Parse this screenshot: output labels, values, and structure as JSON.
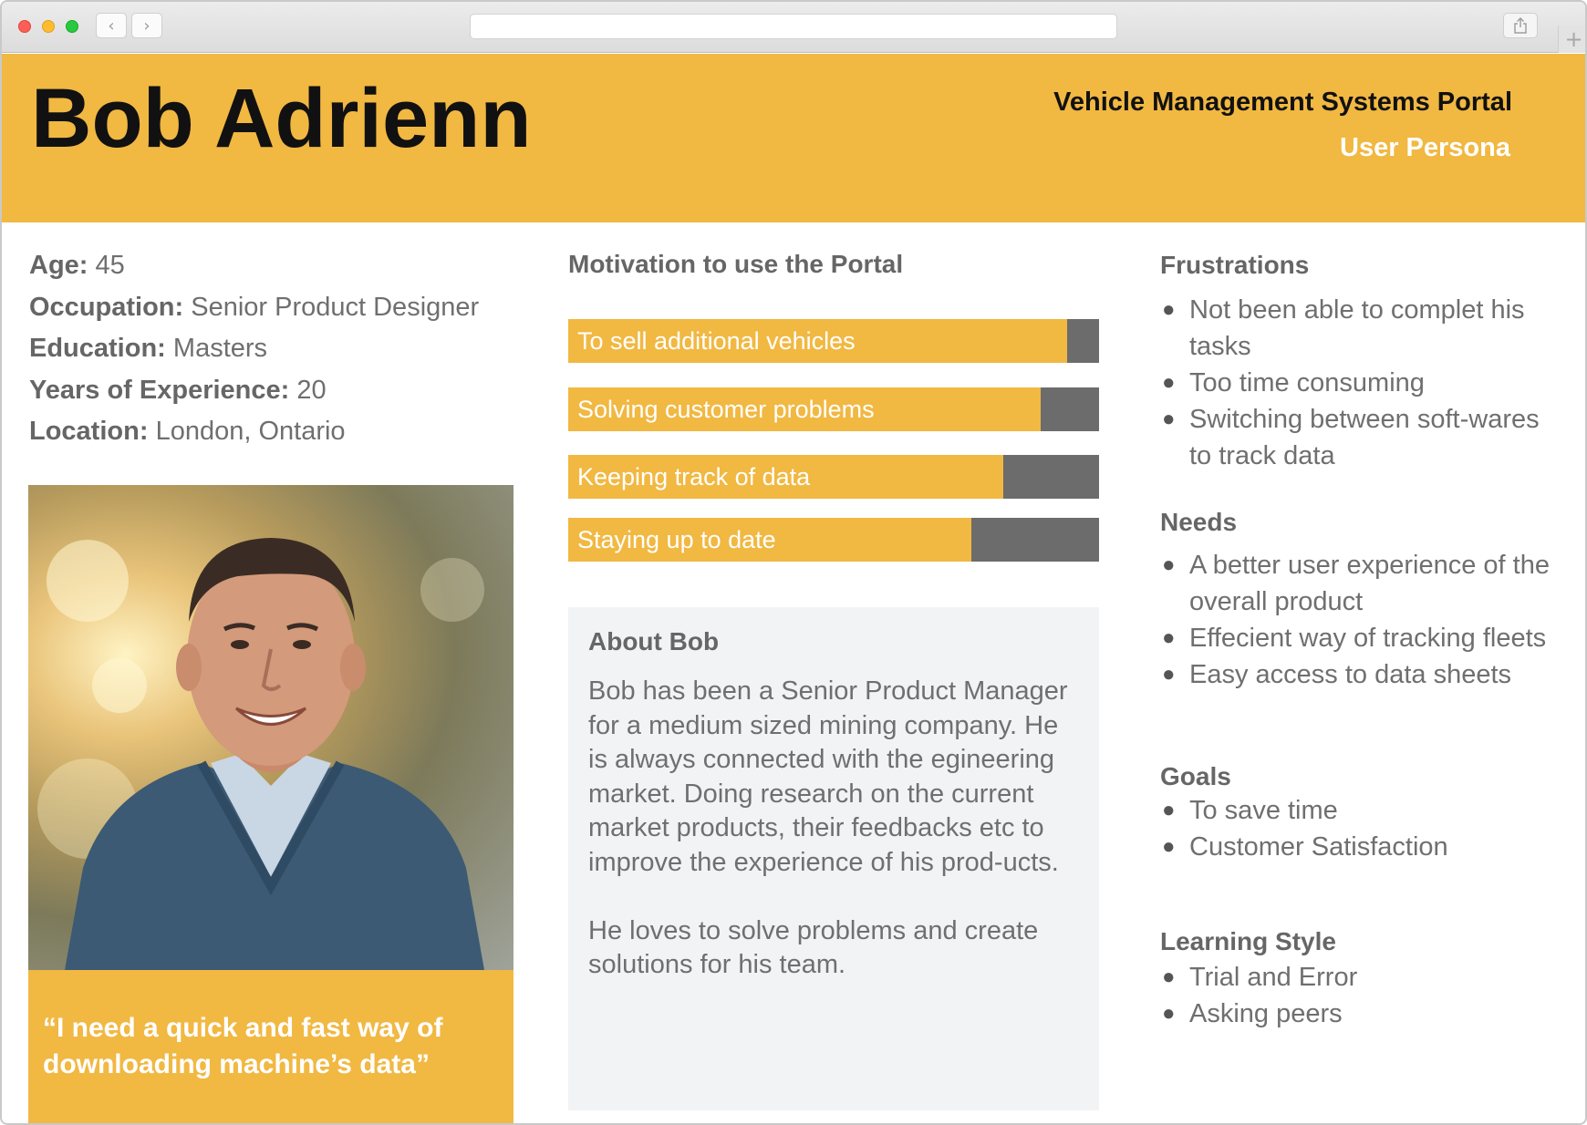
{
  "browser": {
    "back_icon": "chevron-left-icon",
    "forward_icon": "chevron-right-icon",
    "share_icon": "share-icon",
    "new_tab_icon": "plus-icon",
    "url": ""
  },
  "header": {
    "name": "Bob Adrienn",
    "portal_title": "Vehicle Management Systems Portal",
    "subtitle": "User Persona",
    "band_color": "#f1b842"
  },
  "profile": {
    "facts": [
      {
        "label": "Age:",
        "value": "45"
      },
      {
        "label": "Occupation:",
        "value": "Senior Product Designer"
      },
      {
        "label": "Education:",
        "value": "Masters"
      },
      {
        "label": "Years of Experience:",
        "value": "20"
      },
      {
        "label": "Location:",
        "value": "London, Ontario"
      }
    ],
    "quote": "“I need a quick and fast way of downloading machine’s data”"
  },
  "motivation": {
    "title": "Motivation to use the Portal",
    "bars": [
      {
        "label": "To sell additional vehicles",
        "fraction": 0.94
      },
      {
        "label": "Solving customer problems",
        "fraction": 0.89
      },
      {
        "label": "Keeping track of data",
        "fraction": 0.82
      },
      {
        "label": "Staying up to date",
        "fraction": 0.76
      }
    ],
    "fill_color": "#f1b842",
    "track_color": "#6c6c6c"
  },
  "about": {
    "title": "About Bob",
    "paragraphs": [
      "Bob has been a Senior Product Manager for a medium sized mining company. He is always connected with the egineering market. Doing research on the current market products, their feedbacks etc to improve the experience of his prod-ucts.",
      "He loves to solve problems and create solutions for his team."
    ]
  },
  "frustrations": {
    "title": "Frustrations",
    "items": [
      "Not been able to complet his tasks",
      "Too time consuming",
      "Switching between soft-wares to track data"
    ]
  },
  "needs": {
    "title": "Needs",
    "items": [
      "A better user experience of the overall product",
      "Effecient way of tracking fleets",
      "Easy access to data sheets"
    ]
  },
  "goals": {
    "title": "Goals",
    "items": [
      "To save time",
      "Customer Satisfaction"
    ]
  },
  "learning_style": {
    "title": "Learning Style",
    "items": [
      "Trial and Error",
      "Asking peers"
    ]
  },
  "bullet_glyph": "●"
}
